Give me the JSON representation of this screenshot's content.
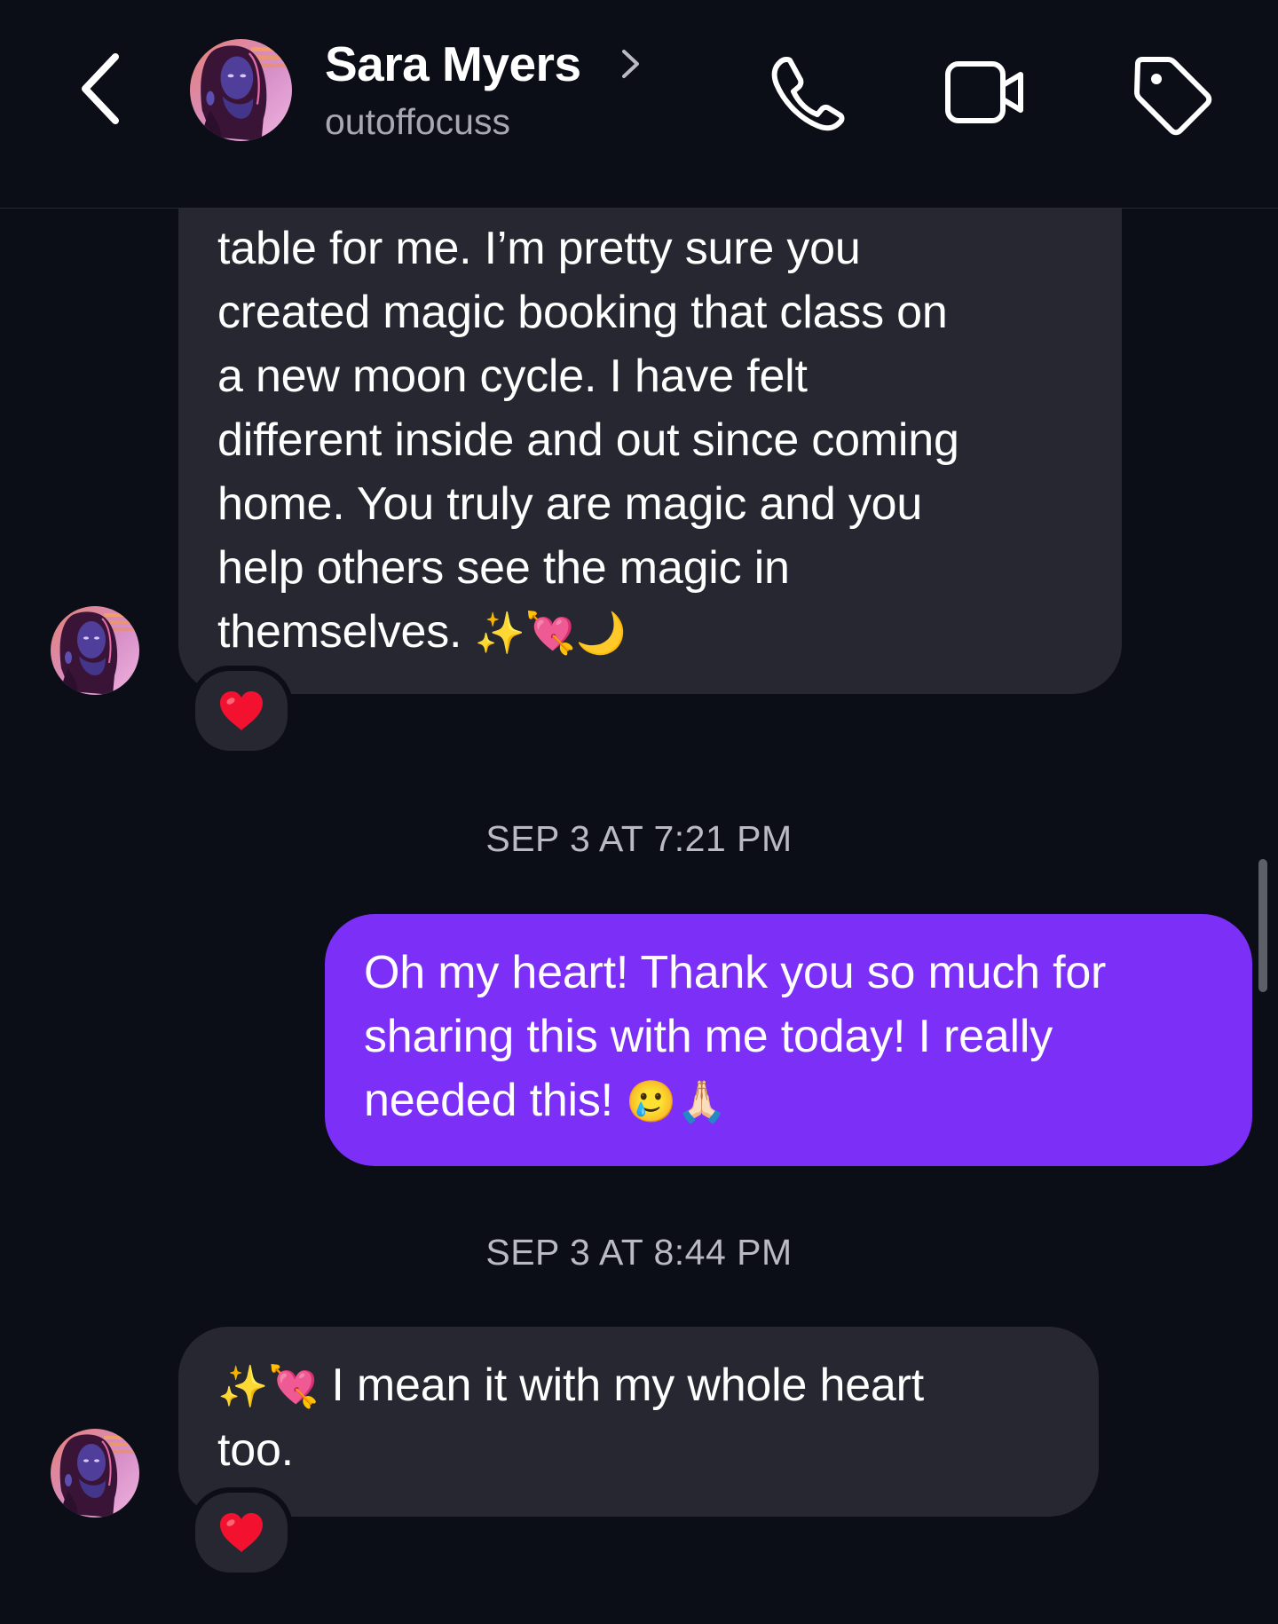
{
  "header": {
    "contact_name": "Sara Myers",
    "username": "outoffocuss",
    "back_icon": "chevron-left-icon",
    "call_icon": "phone-icon",
    "video_icon": "video-camera-icon",
    "tag_icon": "tag-icon"
  },
  "messages": [
    {
      "direction": "incoming",
      "lines": [
        "table for me. I’m pretty sure you",
        "created magic booking that class on",
        "a new moon cycle. I have felt",
        "different inside and out since coming",
        "home. You truly are magic and you",
        "help others see the magic in",
        "themselves."
      ],
      "emojis": "✨💘🌙",
      "reaction": "❤️"
    },
    {
      "direction": "outgoing",
      "timestamp": "SEP 3 AT 7:21 PM",
      "lines": [
        "Oh my heart! Thank you so much for",
        "sharing this with me today! I really",
        "needed this!"
      ],
      "emojis": "🥲🙏🏻"
    },
    {
      "direction": "incoming",
      "timestamp": "SEP 3 AT 8:44 PM",
      "emojis": "✨💘",
      "lines": [
        " I mean it with my whole heart",
        "too."
      ],
      "reaction": "❤️"
    }
  ],
  "colors": {
    "background": "#0c0e17",
    "incoming_bubble": "#262730",
    "outgoing_bubble": "#7b2ff7",
    "secondary_text": "#a7a8b1"
  }
}
